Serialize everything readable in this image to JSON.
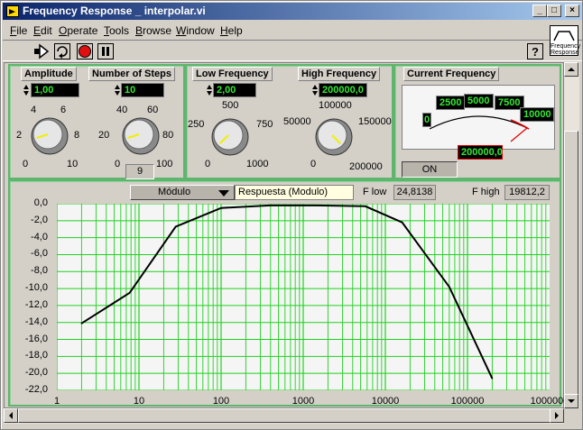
{
  "window": {
    "title": "Frequency Response _ interpolar.vi"
  },
  "menu": [
    {
      "key": "F",
      "rest": "ile"
    },
    {
      "key": "E",
      "rest": "dit"
    },
    {
      "key": "O",
      "rest": "perate"
    },
    {
      "key": "T",
      "rest": "ools"
    },
    {
      "key": "B",
      "rest": "rowse"
    },
    {
      "key": "W",
      "rest": "indow"
    },
    {
      "key": "H",
      "rest": "elp"
    }
  ],
  "vi_icon": {
    "line1": "Frequency",
    "line2": "Response"
  },
  "controls": {
    "amplitude": {
      "label": "Amplitude",
      "value": "1,00",
      "ticks": [
        "0",
        "2",
        "4",
        "6",
        "8",
        "10"
      ],
      "level": 0.1
    },
    "steps": {
      "label": "Number of Steps",
      "value": "10",
      "ticks": [
        "0",
        "20",
        "40",
        "60",
        "80",
        "100"
      ],
      "indicator": "9",
      "level": 0.1
    },
    "low_freq": {
      "label": "Low Frequency",
      "value": "2,00",
      "ticks": [
        "0",
        "250",
        "500",
        "750",
        "1000"
      ],
      "level": 0.002
    },
    "high_freq": {
      "label": "High Frequency",
      "value": "200000,0",
      "ticks": [
        "0",
        "50000",
        "100000",
        "150000",
        "200000"
      ],
      "level": 1.0
    },
    "current_freq": {
      "label": "Current Frequency",
      "value": "200000,0",
      "ticks": [
        "0",
        "2500",
        "5000",
        "7500",
        "10000"
      ],
      "button": "ON"
    }
  },
  "graph": {
    "mode_select": "Módulo",
    "response_label": "Respuesta (Modulo)",
    "flow_label": "F low",
    "flow_value": "24,8138",
    "fhigh_label": "F high",
    "fhigh_value": "19812,2",
    "colors": {
      "grid": "#1fd11f",
      "line": "#000000",
      "background": "#f5f5f5"
    }
  },
  "chart_data": {
    "type": "line",
    "title": "",
    "xlabel": "",
    "ylabel": "",
    "xscale": "log",
    "xlim": [
      1,
      1000000
    ],
    "ylim": [
      -22,
      0
    ],
    "xticks": [
      "1",
      "10",
      "100",
      "1000",
      "10000",
      "100000",
      "1000000"
    ],
    "yticks": [
      "0,0",
      "-2,0",
      "-4,0",
      "-6,0",
      "-8,0",
      "-10,0",
      "-12,0",
      "-14,0",
      "-16,0",
      "-18,0",
      "-20,0",
      "-22,0"
    ],
    "grid": true,
    "series": [
      {
        "x": [
          2,
          7.7,
          28,
          100,
          390,
          1500,
          5700,
          16000,
          60000,
          200000
        ],
        "y": [
          -14.1,
          -10.5,
          -2.7,
          -0.5,
          -0.2,
          -0.2,
          -0.3,
          -2.2,
          -9.8,
          -20.6
        ]
      }
    ]
  }
}
